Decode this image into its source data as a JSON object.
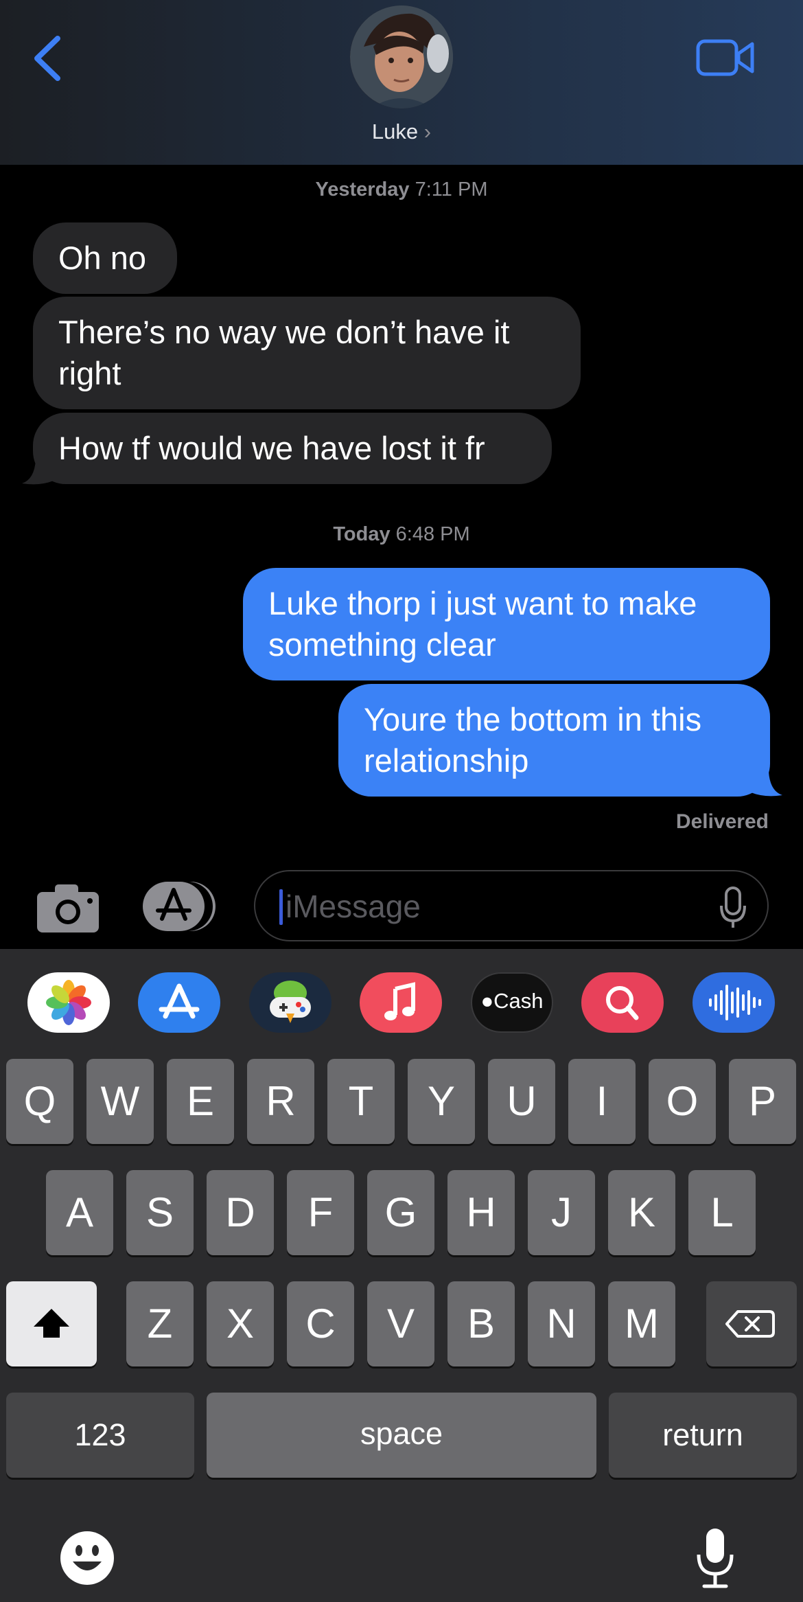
{
  "header": {
    "contact_name": "Luke",
    "chevron": "›",
    "back_icon": "chevron-left-icon",
    "video_icon": "video-camera-icon"
  },
  "conversation": {
    "timestamp1": {
      "day": "Yesterday",
      "time": "7:11 PM"
    },
    "incoming": [
      {
        "lines": [
          "Oh no"
        ]
      },
      {
        "lines": [
          "There’s no way we don’t have it",
          "right"
        ]
      },
      {
        "lines": [
          "How tf would we have lost it fr"
        ]
      }
    ],
    "timestamp2": {
      "day": "Today",
      "time": "6:48 PM"
    },
    "outgoing": [
      {
        "lines": [
          "Luke thorp i just want to make",
          "something clear"
        ]
      },
      {
        "lines": [
          "Youre the bottom in this",
          "relationship"
        ]
      }
    ],
    "status": "Delivered"
  },
  "composer": {
    "placeholder": "iMessage",
    "camera_icon": "camera-icon",
    "apps_icon": "app-store-icon",
    "mic_icon": "microphone-icon"
  },
  "app_strip": [
    {
      "name": "photos-icon",
      "label": ""
    },
    {
      "name": "app-store-icon",
      "label": ""
    },
    {
      "name": "game-pigeon-icon",
      "label": ""
    },
    {
      "name": "music-icon",
      "label": ""
    },
    {
      "name": "apple-cash-icon",
      "label": "Cash"
    },
    {
      "name": "search-images-icon",
      "label": ""
    },
    {
      "name": "audio-message-icon",
      "label": ""
    }
  ],
  "keyboard": {
    "row1": [
      "Q",
      "W",
      "E",
      "R",
      "T",
      "Y",
      "U",
      "I",
      "O",
      "P"
    ],
    "row2": [
      "A",
      "S",
      "D",
      "F",
      "G",
      "H",
      "J",
      "K",
      "L"
    ],
    "row3": [
      "Z",
      "X",
      "C",
      "V",
      "B",
      "N",
      "M"
    ],
    "numbers": "123",
    "space": "space",
    "return": "return",
    "emoji_icon": "emoji-icon",
    "dictation_icon": "microphone-icon"
  },
  "colors": {
    "outgoing_bubble": "#3b82f6",
    "incoming_bubble": "#262628",
    "accent": "#3d7ff5"
  }
}
